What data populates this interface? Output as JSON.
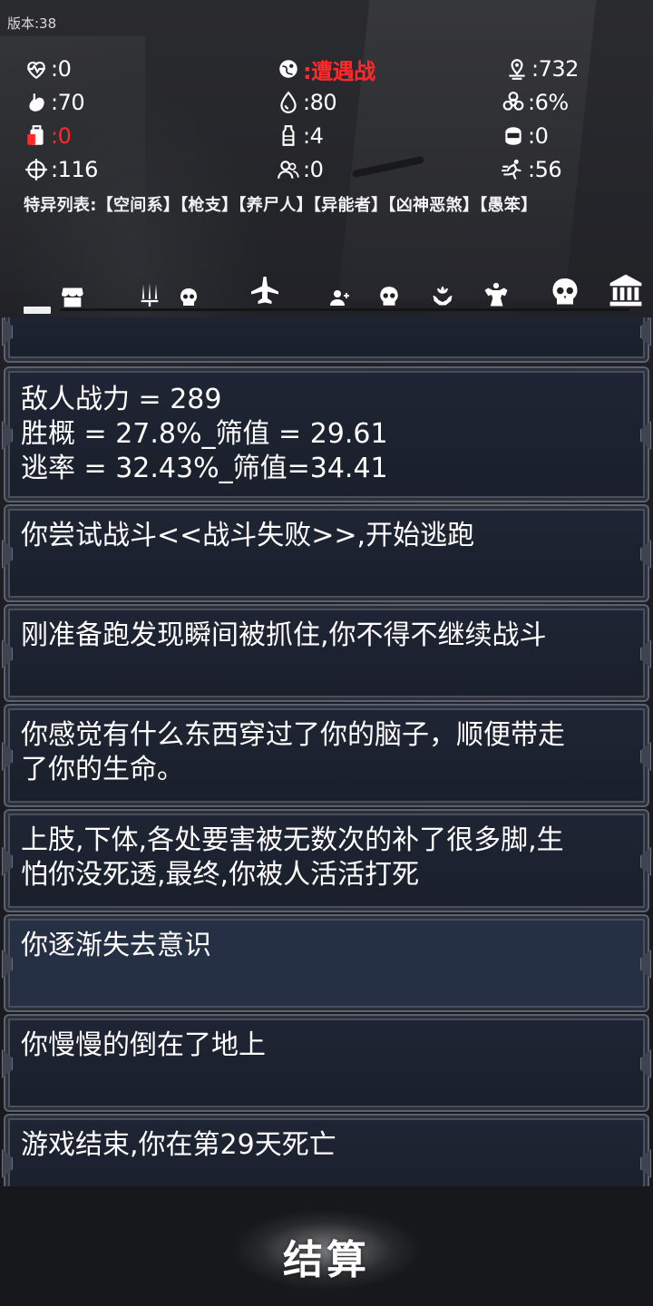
{
  "version": "版本:38",
  "stats": [
    {
      "icon": "heartbeat-icon",
      "value": ":0",
      "color": "#ffffff"
    },
    {
      "icon": "globe-person-icon",
      "value": ":遭遇战",
      "color": "#ff2a2a"
    },
    {
      "icon": "location-pin-icon",
      "value": ":732",
      "color": "#ffffff"
    },
    {
      "icon": "stomach-icon",
      "value": ":70",
      "color": "#ffffff"
    },
    {
      "icon": "water-drop-icon",
      "value": ":80",
      "color": "#ffffff"
    },
    {
      "icon": "biohazard-icon",
      "value": ":6%",
      "color": "#ffffff"
    },
    {
      "icon": "food-pack-icon",
      "value": ":0",
      "color": "#ff2a2a"
    },
    {
      "icon": "bottle-icon",
      "value": ":4",
      "color": "#ffffff"
    },
    {
      "icon": "helmet-icon",
      "value": ":0",
      "color": "#ffffff"
    },
    {
      "icon": "crosshair-icon",
      "value": ":116",
      "color": "#ffffff"
    },
    {
      "icon": "users-icon",
      "value": ":0",
      "color": "#ffffff"
    },
    {
      "icon": "runner-icon",
      "value": ":56",
      "color": "#ffffff"
    }
  ],
  "traits": "特异列表:【空间系】【枪支】【养尸人】【异能者】【凶神恶煞】【愚笨】",
  "nav": [
    {
      "icon": "home-tab-icon"
    },
    {
      "icon": "shop-icon"
    },
    {
      "icon": "weapons-icon"
    },
    {
      "icon": "skull-icon"
    },
    {
      "icon": "airplane-icon"
    },
    {
      "icon": "add-user-icon"
    },
    {
      "icon": "skull-icon"
    },
    {
      "icon": "lotus-hands-icon"
    },
    {
      "icon": "muscle-icon"
    },
    {
      "icon": "skull-large-icon"
    },
    {
      "icon": "bank-icon"
    }
  ],
  "log": [
    {
      "text": ""
    },
    {
      "text": "敌人战力 = 289\n胜概 = 27.8%_筛值 = 29.61\n逃率 = 32.43%_筛值=34.41"
    },
    {
      "text": "你尝试战斗<<战斗失败>>,开始逃跑"
    },
    {
      "text": "刚准备跑发现瞬间被抓住,你不得不继续战斗"
    },
    {
      "text": "你感觉有什么东西穿过了你的脑子，顺便带走\n了你的生命。"
    },
    {
      "text": "上肢,下体,各处要害被无数次的补了很多脚,生\n怕你没死透,最终,你被人活活打死"
    },
    {
      "text": "你逐渐失去意识"
    },
    {
      "text": "你慢慢的倒在了地上"
    },
    {
      "text": "游戏结束,你在第29天死亡"
    }
  ],
  "settle_button": "结算"
}
